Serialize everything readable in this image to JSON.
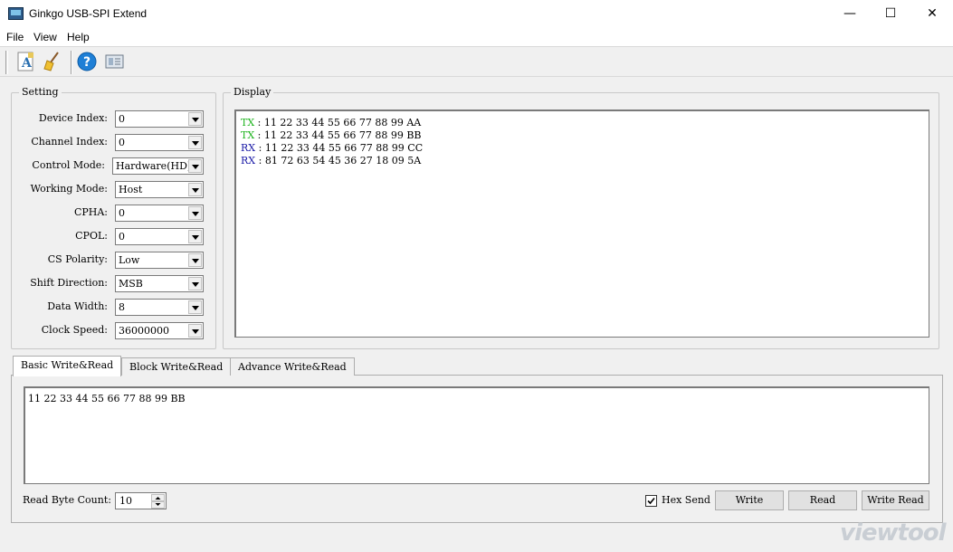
{
  "window": {
    "title": "Ginkgo USB-SPI Extend",
    "min": "—",
    "max": "☐",
    "close": "✕"
  },
  "menu": [
    "File",
    "View",
    "Help"
  ],
  "setting": {
    "title": "Setting",
    "fields": [
      {
        "label": "Device Index:",
        "value": "0"
      },
      {
        "label": "Channel Index:",
        "value": "0"
      },
      {
        "label": "Control Mode:",
        "value": "Hardware(HD)"
      },
      {
        "label": "Working Mode:",
        "value": "Host"
      },
      {
        "label": "CPHA:",
        "value": "0"
      },
      {
        "label": "CPOL:",
        "value": "0"
      },
      {
        "label": "CS Polarity:",
        "value": "Low"
      },
      {
        "label": "Shift Direction:",
        "value": "MSB"
      },
      {
        "label": "Data Width:",
        "value": "8"
      },
      {
        "label": "Clock Speed:",
        "value": "36000000"
      }
    ]
  },
  "display": {
    "title": "Display",
    "lines": [
      {
        "dir": "TX",
        "sep": ":",
        "data": "11 22 33 44 55 66 77 88 99 AA"
      },
      {
        "dir": "TX",
        "sep": ":",
        "data": "11 22 33 44 55 66 77 88 99 BB"
      },
      {
        "dir": "RX",
        "sep": ":",
        "data": "11 22 33 44 55 66 77 88 99 CC"
      },
      {
        "dir": "RX",
        "sep": ":",
        "data": "81 72 63 54 45 36 27 18 09 5A"
      }
    ],
    "tx_color": "#1db31d",
    "rx_color": "#1a1aa6"
  },
  "tabs": [
    "Basic Write&Read",
    "Block Write&Read",
    "Advance Write&Read"
  ],
  "basic": {
    "send_data": "11 22 33 44 55 66 77 88 99 BB",
    "read_count_label": "Read Byte Count:",
    "read_count_value": "10",
    "hex_send_label": "Hex Send",
    "hex_send_checked": true,
    "write_label": "Write",
    "read_label": "Read",
    "write_read_label": "Write Read"
  },
  "watermark": "viewtool"
}
